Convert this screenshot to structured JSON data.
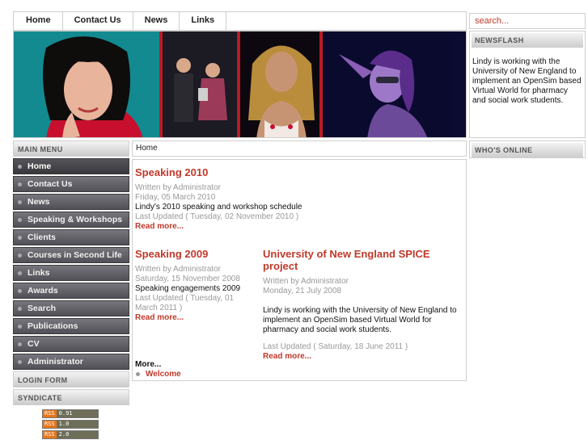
{
  "topnav": {
    "items": [
      "Home",
      "Contact Us",
      "News",
      "Links"
    ]
  },
  "search": {
    "placeholder": "search..."
  },
  "newsflash": {
    "title": "NEWSFLASH",
    "text": "Lindy is working with the University of New England to implement an OpenSim based Virtual World for pharmacy and social work students."
  },
  "whos_online": {
    "title": "WHO'S ONLINE"
  },
  "breadcrumb": {
    "text": "Home"
  },
  "menu": {
    "title": "MAIN MENU",
    "items": [
      "Home",
      "Contact Us",
      "News",
      "Speaking & Workshops",
      "Clients",
      "Courses in Second Life",
      "Links",
      "Awards",
      "Search",
      "Publications",
      "CV"
    ],
    "admin_label": "Administrator"
  },
  "login": {
    "title": "LOGIN FORM"
  },
  "syndicate": {
    "title": "SYNDICATE",
    "feeds": [
      {
        "tag": "RSS",
        "version": "0.91"
      },
      {
        "tag": "RSS",
        "version": "1.0"
      },
      {
        "tag": "RSS",
        "version": "2.0"
      }
    ]
  },
  "articles": [
    {
      "title": "Speaking 2010",
      "author": "Written by Administrator",
      "date": "Friday, 05 March 2010",
      "body": "Lindy's 2010 speaking and workshop schedule",
      "updated": "Last Updated ( Tuesday, 02 November 2010 )",
      "readmore": "Read more..."
    },
    {
      "title": "Speaking 2009",
      "author": "Written by Administrator",
      "date": "Saturday, 15 November 2008",
      "body": "Speaking engagements 2009",
      "updated": "Last Updated ( Tuesday, 01 March 2011 )",
      "readmore": "Read more..."
    },
    {
      "title": "University of New England SPICE project",
      "author": "Written by Administrator",
      "date": "Monday, 21 July 2008",
      "body": "Lindy is working with the University of New England to implement an OpenSim based Virtual World for pharmacy and social work students.",
      "updated": "Last Updated ( Saturday, 18 June 2011 )",
      "readmore": "Read more..."
    }
  ],
  "more": {
    "heading": "More...",
    "items": [
      "Welcome"
    ]
  },
  "colors": {
    "accent": "#c0392b",
    "menu_bg": "#5f5f65",
    "banner_red": "#b71c24"
  }
}
